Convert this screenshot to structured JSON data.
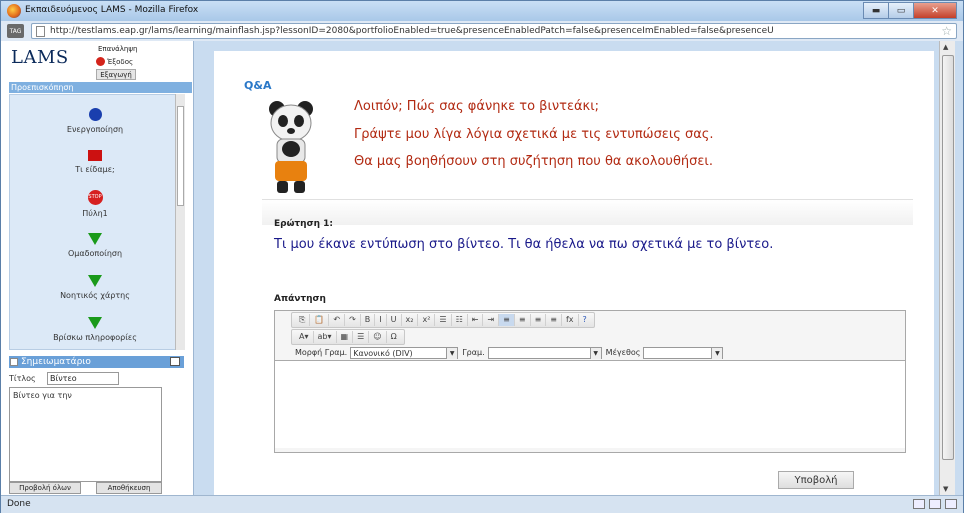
{
  "browser": {
    "title": "Εκπαιδευόμενος LAMS - Mozilla Firefox",
    "tag_label": "TAG",
    "url": "http://testlams.eap.gr/lams/learning/mainflash.jsp?lessonID=2080&portfolioEnabled=true&presenceEnabledPatch=false&presenceImEnabled=false&presenceU",
    "status": "Done",
    "min_glyph": "▬",
    "max_glyph": "▭",
    "close_glyph": "✕"
  },
  "sidebar": {
    "logo": "LAMS",
    "buttons": {
      "repeat": "Επανάληψη",
      "exit": "Έξοδος",
      "export": "Εξαγωγή"
    },
    "preview_header": "Προεπισκόπηση",
    "steps": [
      {
        "label": "Ενεργοποίηση",
        "shape": "circle"
      },
      {
        "label": "Τι είδαμε;",
        "shape": "square"
      },
      {
        "label": "Πύλη1",
        "shape": "stop"
      },
      {
        "label": "Ομαδοποίηση",
        "shape": "triangle"
      },
      {
        "label": "Νοητικός χάρτης",
        "shape": "triangle"
      },
      {
        "label": "Βρίσκω πληροφορίες",
        "shape": "triangle"
      }
    ],
    "stop_text": "STOP",
    "notebook_header": "Σημειωματάριο",
    "title_label": "Τίτλος",
    "title_value": "Βίντεο",
    "note_text": "Βίντεο για την",
    "view_all": "Προβολή όλων",
    "save": "Αποθήκευση"
  },
  "main": {
    "qa_title": "Q&A",
    "intro_lines": [
      "Λοιπόν; Πώς σας φάνηκε το βιντεάκι;",
      "Γράψτε μου λίγα λόγια σχετικά με τις εντυπώσεις σας.",
      "Θα μας βοηθήσουν στη συζήτηση που θα ακολουθήσει."
    ],
    "question_label": "Ερώτηση 1:",
    "question_text": "Τι μου έκανε εντύπωση στο βίντεο. Τι θα ήθελα να πω σχετικά με το βίντεο.",
    "answer_label": "Απάντηση",
    "editor": {
      "format_label": "Μορφή Γραμ.",
      "format_value": "Κανονικό (DIV)",
      "font_label": "Γραμ.",
      "font_value": "",
      "size_label": "Μέγεθος",
      "size_value": "",
      "toolbar1": [
        "⎘",
        "📋",
        "↶",
        "↷",
        "B",
        "I",
        "U",
        "x₂",
        "x²",
        "☰",
        "☷",
        "⇤",
        "⇥",
        "≡",
        "≡",
        "≡",
        "≡",
        "fx",
        "?"
      ],
      "toolbar2": [
        "A▾",
        "ab▾",
        "▦",
        "☰",
        "☺",
        "Ω"
      ],
      "content": ""
    },
    "submit": "Υποβολή"
  }
}
